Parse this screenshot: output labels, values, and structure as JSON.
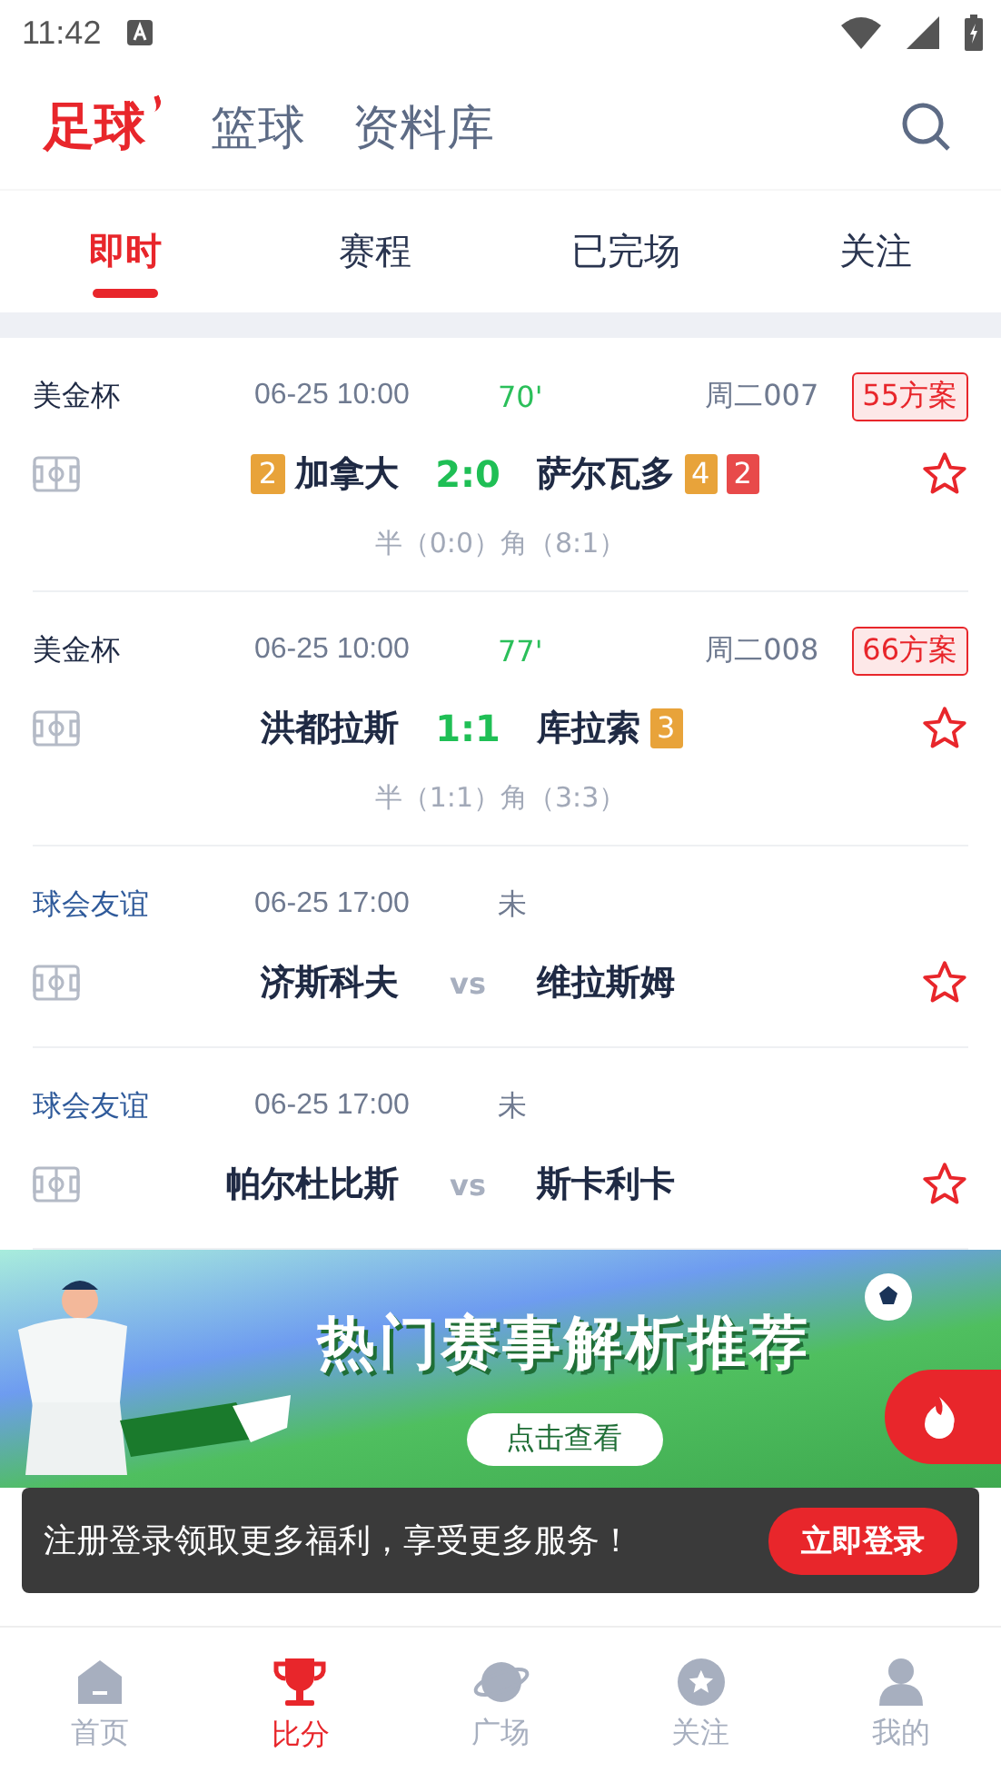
{
  "status_bar": {
    "time": "11:42"
  },
  "sports_tabs": [
    {
      "label": "足球",
      "selected": true
    },
    {
      "label": "篮球",
      "selected": false
    },
    {
      "label": "资料库",
      "selected": false
    }
  ],
  "sub_tabs": [
    {
      "label": "即时",
      "selected": true
    },
    {
      "label": "赛程",
      "selected": false
    },
    {
      "label": "已完场",
      "selected": false
    },
    {
      "label": "关注",
      "selected": false
    }
  ],
  "matches": [
    {
      "league": "美金杯",
      "color": "#1f2a44",
      "time": "06-25 10:00",
      "status": "70'",
      "kind": "live",
      "code": "周二007",
      "plans": "55方案",
      "home": {
        "name": "加拿大",
        "badges": [
          {
            "text": "2",
            "color": "#e8a33a"
          }
        ]
      },
      "score": "2:0",
      "away": {
        "name": "萨尔瓦多",
        "badges": [
          {
            "text": "4",
            "color": "#e8a33a"
          },
          {
            "text": "2",
            "color": "#e84a4a"
          }
        ]
      },
      "detail": "半（0:0）角（8:1）",
      "starred": false
    },
    {
      "league": "美金杯",
      "color": "#1f2a44",
      "time": "06-25 10:00",
      "status": "77'",
      "kind": "live",
      "code": "周二008",
      "plans": "66方案",
      "home": {
        "name": "洪都拉斯"
      },
      "score": "1:1",
      "away": {
        "name": "库拉索",
        "badges": [
          {
            "text": "3",
            "color": "#e8a33a"
          }
        ]
      },
      "detail": "半（1:1）角（3:3）",
      "starred": false
    },
    {
      "league": "球会友谊",
      "color": "#2f5a9a",
      "time": "06-25 17:00",
      "status": "未",
      "kind": "pending",
      "home": {
        "name": "济斯科夫"
      },
      "score": "vs",
      "away": {
        "name": "维拉斯姆"
      },
      "starred": false
    },
    {
      "league": "球会友谊",
      "color": "#2f5a9a",
      "time": "06-25 17:00",
      "status": "未",
      "kind": "pending",
      "home": {
        "name": "帕尔杜比斯"
      },
      "score": "vs",
      "away": {
        "name": "斯卡利卡"
      },
      "starred": false
    }
  ],
  "banner": {
    "title": "热门赛事解析推荐",
    "button": "点击查看"
  },
  "toast": {
    "message": "注册登录领取更多福利，享受更多服务！",
    "button": "立即登录"
  },
  "bottom_nav": [
    {
      "label": "首页",
      "kind": "home",
      "selected": false
    },
    {
      "label": "比分",
      "kind": "trophy",
      "selected": true
    },
    {
      "label": "广场",
      "kind": "planet",
      "selected": false
    },
    {
      "label": "关注",
      "kind": "star",
      "selected": false
    },
    {
      "label": "我的",
      "kind": "user",
      "selected": false
    }
  ]
}
